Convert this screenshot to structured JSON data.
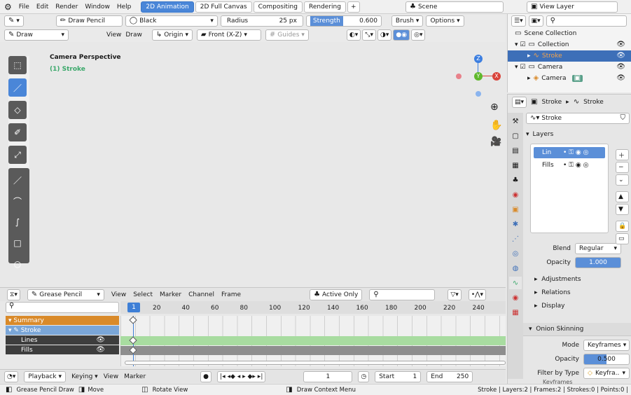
{
  "menubar": {
    "items": [
      "File",
      "Edit",
      "Render",
      "Window",
      "Help"
    ],
    "tabs": [
      "2D Animation",
      "2D Full Canvas",
      "Compositing",
      "Rendering"
    ],
    "active_tab": "2D Animation",
    "add_tab": "+",
    "scene": "Scene",
    "view_layer": "View Layer"
  },
  "tool_header": {
    "brush": "Draw Pencil",
    "material": "Black",
    "radius_label": "Radius",
    "radius_value": "25 px",
    "strength_label": "Strength",
    "strength_value": "0.600",
    "brush_menu": "Brush",
    "options_menu": "Options"
  },
  "viewport_header": {
    "mode": "Draw",
    "view": "View",
    "draw": "Draw",
    "origin": "Origin",
    "orientation": "Front (X-Z)",
    "guides": "Guides"
  },
  "viewport": {
    "perspective": "Camera Perspective",
    "object": "(1) Stroke",
    "gizmo": {
      "z": "Z",
      "y": "Y",
      "x": "X"
    }
  },
  "outliner": {
    "root": "Scene Collection",
    "collection": "Collection",
    "stroke": "Stroke",
    "camera": "Camera",
    "camera_data": "Camera"
  },
  "properties": {
    "breadcrumb_obj": "Stroke",
    "breadcrumb_data": "Stroke",
    "datablock": "Stroke",
    "layers_title": "Layers",
    "layers": [
      "Lin",
      "Fills"
    ],
    "blend_label": "Blend",
    "blend_value": "Regular",
    "opacity_label": "Opacity",
    "opacity_value": "1.000",
    "panels": [
      "Adjustments",
      "Relations",
      "Display"
    ],
    "onion_title": "Onion Skinning",
    "mode_label": "Mode",
    "mode_value": "Keyframes",
    "onion_opacity_label": "Opacity",
    "onion_opacity_value": "0.500",
    "filter_label": "Filter by Type",
    "filter_value": "Keyfra..",
    "keyframes_label": "Keyframes"
  },
  "dopesheet": {
    "mode": "Grease Pencil",
    "menus": [
      "View",
      "Select",
      "Marker",
      "Channel",
      "Frame"
    ],
    "active_only": "Active Only",
    "current_frame": "1",
    "ticks": [
      "20",
      "40",
      "60",
      "80",
      "100",
      "120",
      "140",
      "160",
      "180",
      "200",
      "220",
      "240"
    ],
    "rows": [
      "Summary",
      "Stroke",
      "Lines",
      "Fills"
    ]
  },
  "playback": {
    "playback": "Playback",
    "keying": "Keying",
    "view": "View",
    "marker": "Marker",
    "frame": "1",
    "start_label": "Start",
    "start": "1",
    "end_label": "End",
    "end": "250"
  },
  "statusbar": {
    "a": "Grease Pencil Draw",
    "b": "Move",
    "c": "Rotate View",
    "d": "Draw Context Menu",
    "stats": "Stroke | Layers:2 | Frames:2 | Strokes:0 | Points:0 |"
  },
  "colors": {
    "accent": "#4a86d8",
    "active_tab": "#4a86d8",
    "summary": "#d98a2a",
    "stroke_row": "#7aa6d8",
    "lines_row": "#a8dca0",
    "fills_row": "#8e8e8e",
    "playhead": "#3e7fd6",
    "gizmo_z": "#3c7ee0",
    "gizmo_y": "#5fb82c",
    "gizmo_x": "#d9443b"
  }
}
